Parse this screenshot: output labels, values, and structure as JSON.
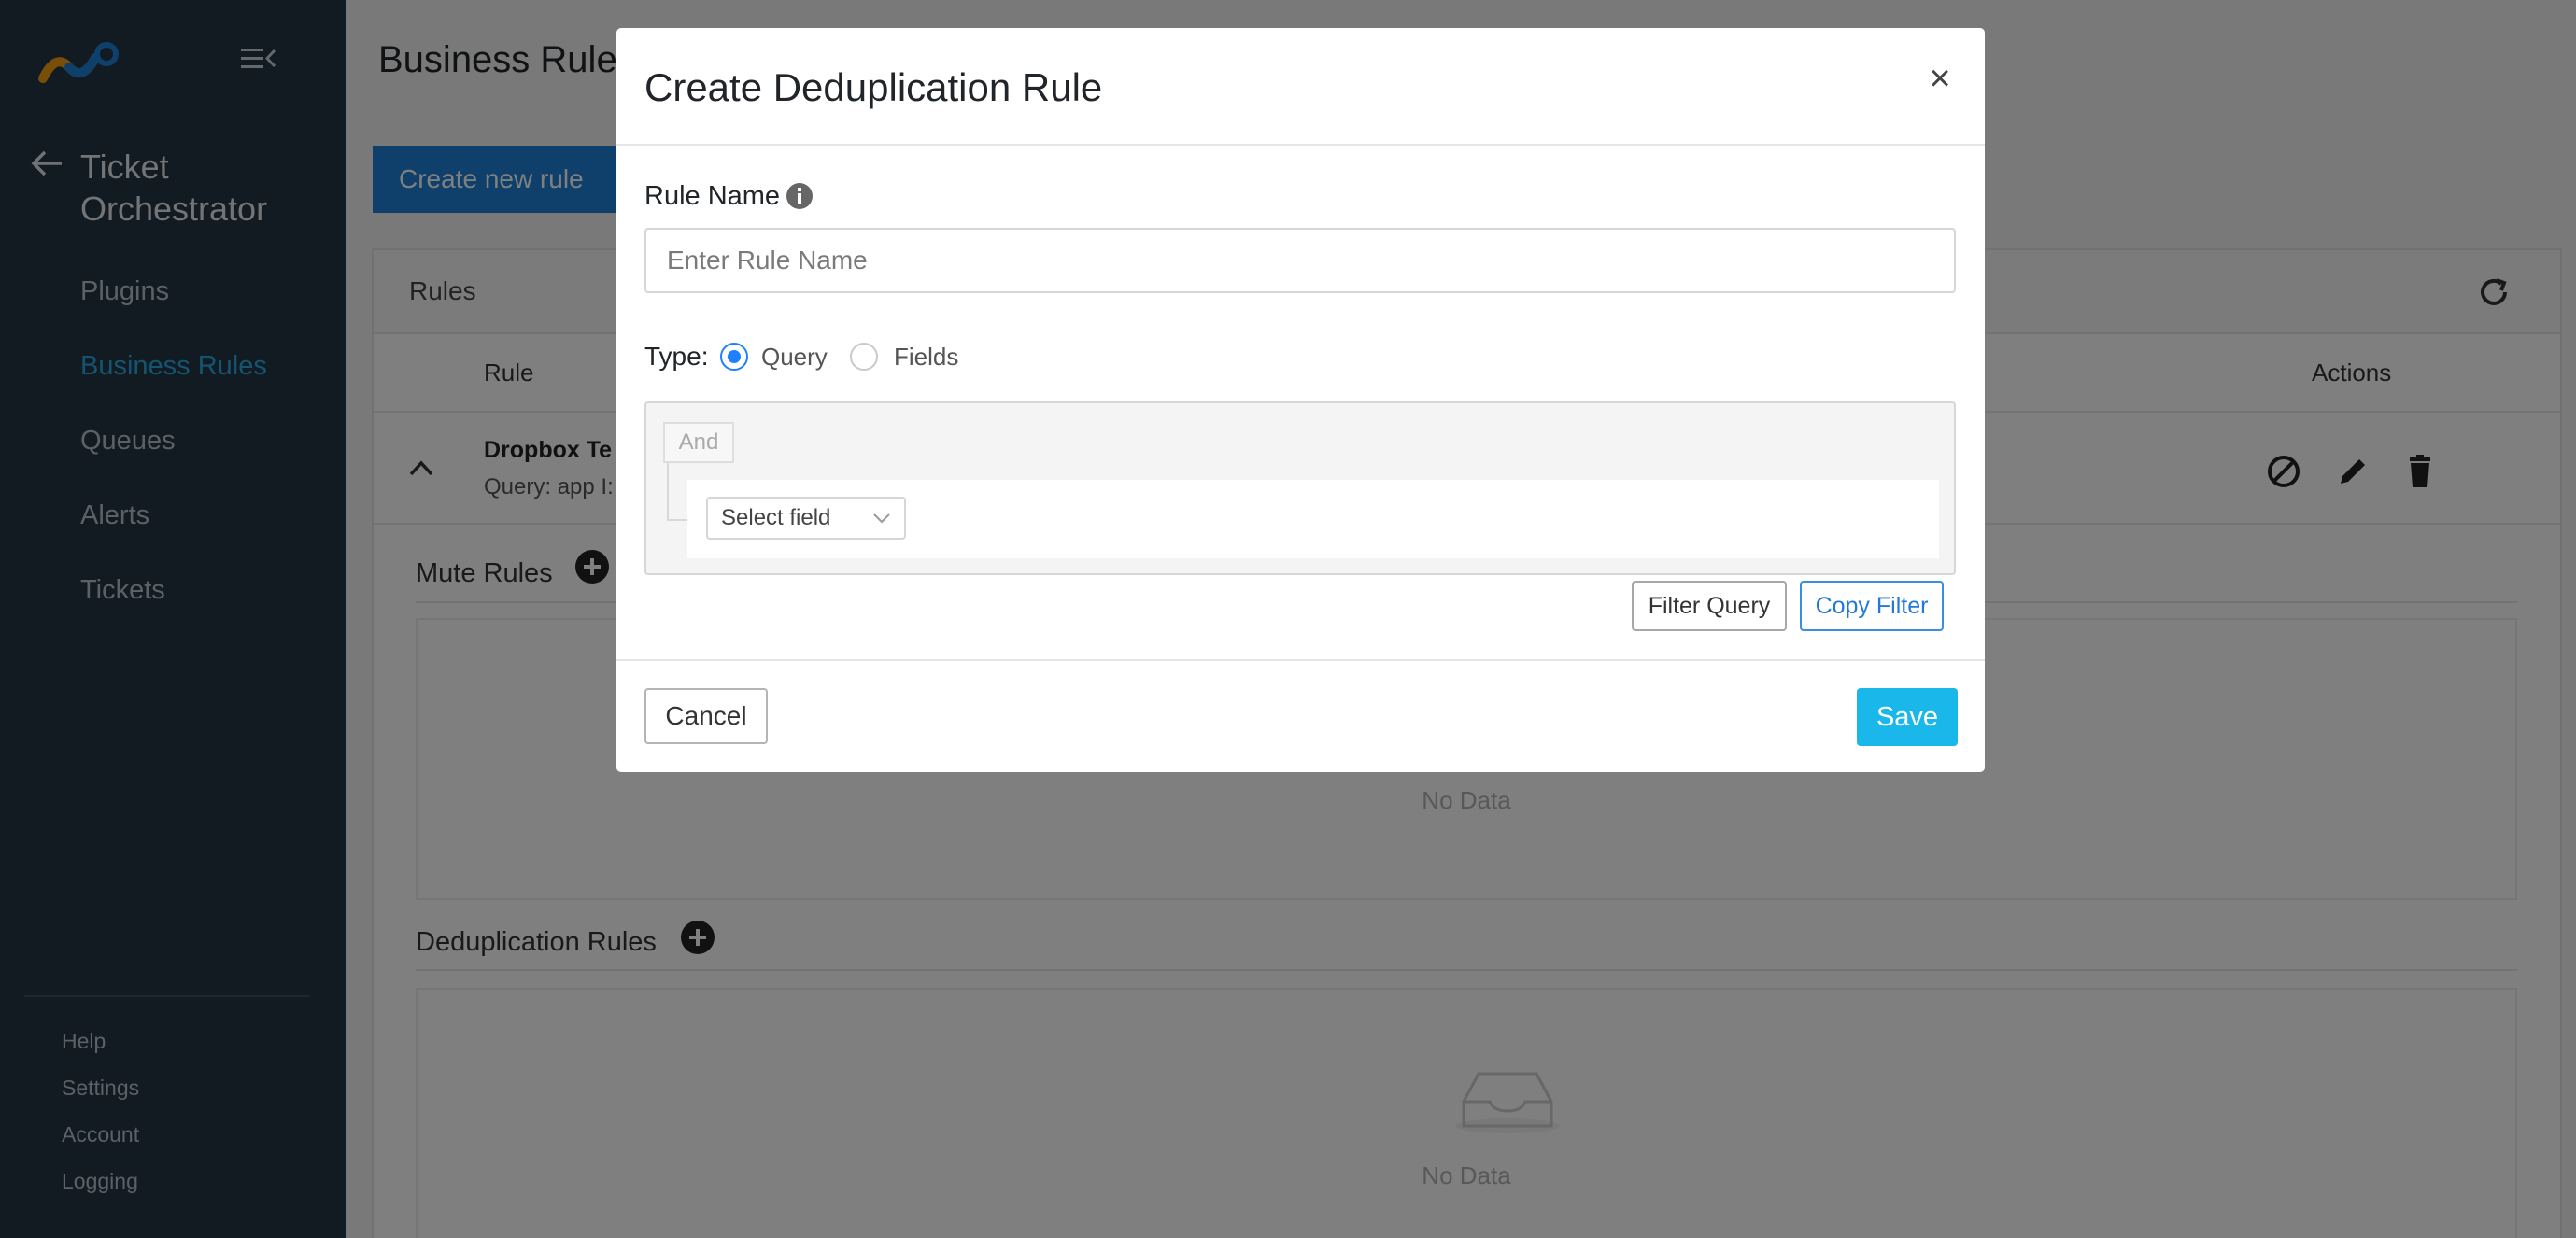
{
  "sidebar": {
    "logo_icon": "nodes-logo-icon",
    "app_title": "Ticket\nOrchestrator",
    "nav": [
      {
        "label": "Plugins",
        "active": false
      },
      {
        "label": "Business Rules",
        "active": true
      },
      {
        "label": "Queues",
        "active": false
      },
      {
        "label": "Alerts",
        "active": false
      },
      {
        "label": "Tickets",
        "active": false
      }
    ],
    "footer": [
      {
        "label": "Help"
      },
      {
        "label": "Settings"
      },
      {
        "label": "Account"
      },
      {
        "label": "Logging"
      }
    ]
  },
  "page": {
    "title": "Business Rules",
    "create_button": "Create new rule",
    "rules_card": {
      "title": "Rules",
      "columns": {
        "rule": "Rule",
        "actions": "Actions"
      },
      "row": {
        "name": "Dropbox Te",
        "query": "Query: app I:"
      },
      "mute_section": {
        "title": "Mute Rules",
        "empty_text": "No Data"
      },
      "dedup_section": {
        "title": "Deduplication Rules",
        "empty_text": "No Data"
      }
    }
  },
  "modal": {
    "title": "Create Deduplication Rule",
    "close_label": "×",
    "rule_name_label": "Rule Name",
    "rule_name_placeholder": "Enter Rule Name",
    "rule_name_value": "",
    "type_label": "Type:",
    "type_options": [
      {
        "label": "Query",
        "selected": true
      },
      {
        "label": "Fields",
        "selected": false
      }
    ],
    "query_builder": {
      "combinator": "And",
      "field_placeholder": "Select field"
    },
    "filter_query_button": "Filter Query",
    "copy_filter_button": "Copy Filter",
    "cancel_button": "Cancel",
    "save_button": "Save"
  },
  "colors": {
    "sidebar_bg": "#253544",
    "active_nav": "#29a9e0",
    "primary": "#1f80d8",
    "save": "#1ab7ea",
    "radio_selected": "#1f80ff"
  }
}
